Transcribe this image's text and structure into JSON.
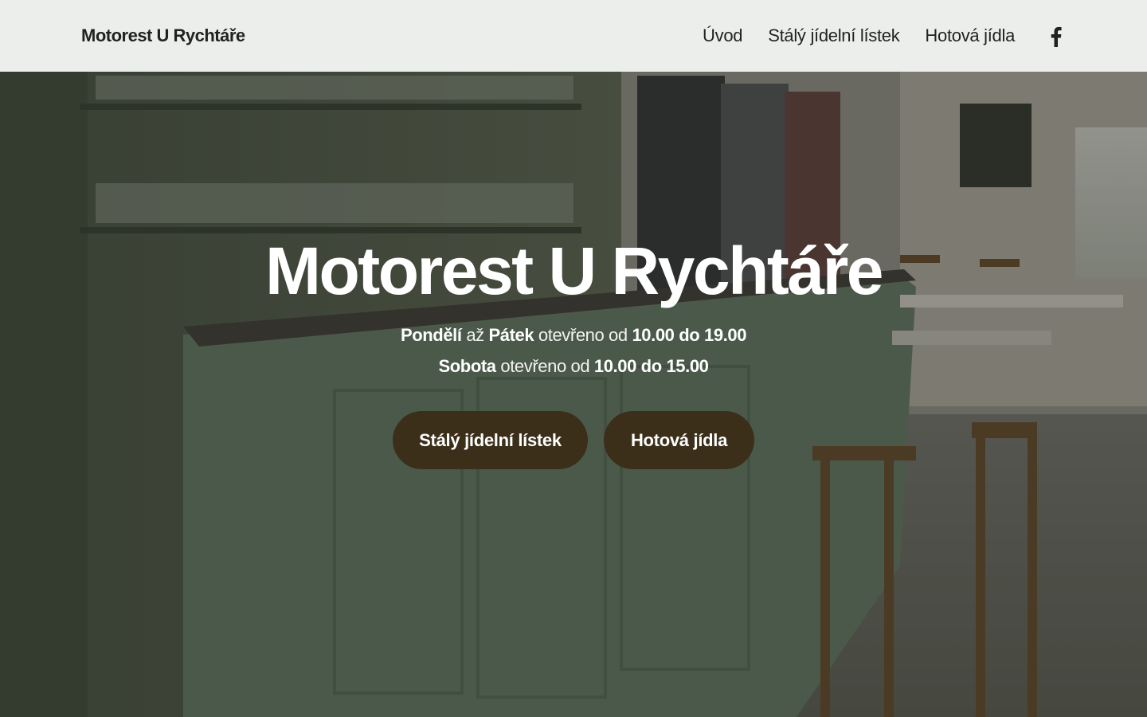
{
  "header": {
    "brand": "Motorest U Rychtáře",
    "nav": [
      "Úvod",
      "Stálý jídelní lístek",
      "Hotová jídla"
    ],
    "social_icon": "facebook-icon"
  },
  "hero": {
    "title": "Motorest U Rychtáře",
    "hours_line1": {
      "day_from": "Pondělí",
      "joiner": "až",
      "day_to": "Pátek",
      "text": "otevřeno od",
      "time": "10.00 do 19.00"
    },
    "hours_line2": {
      "day": "Sobota",
      "text": "otevřeno od",
      "time": "10.00 do 15.00"
    },
    "buttons": [
      "Stálý jídelní lístek",
      "Hotová jídla"
    ]
  },
  "colors": {
    "header_bg": "#eceeeb",
    "button_bg": "#3b2f1a",
    "text_dark": "#1f2220"
  }
}
